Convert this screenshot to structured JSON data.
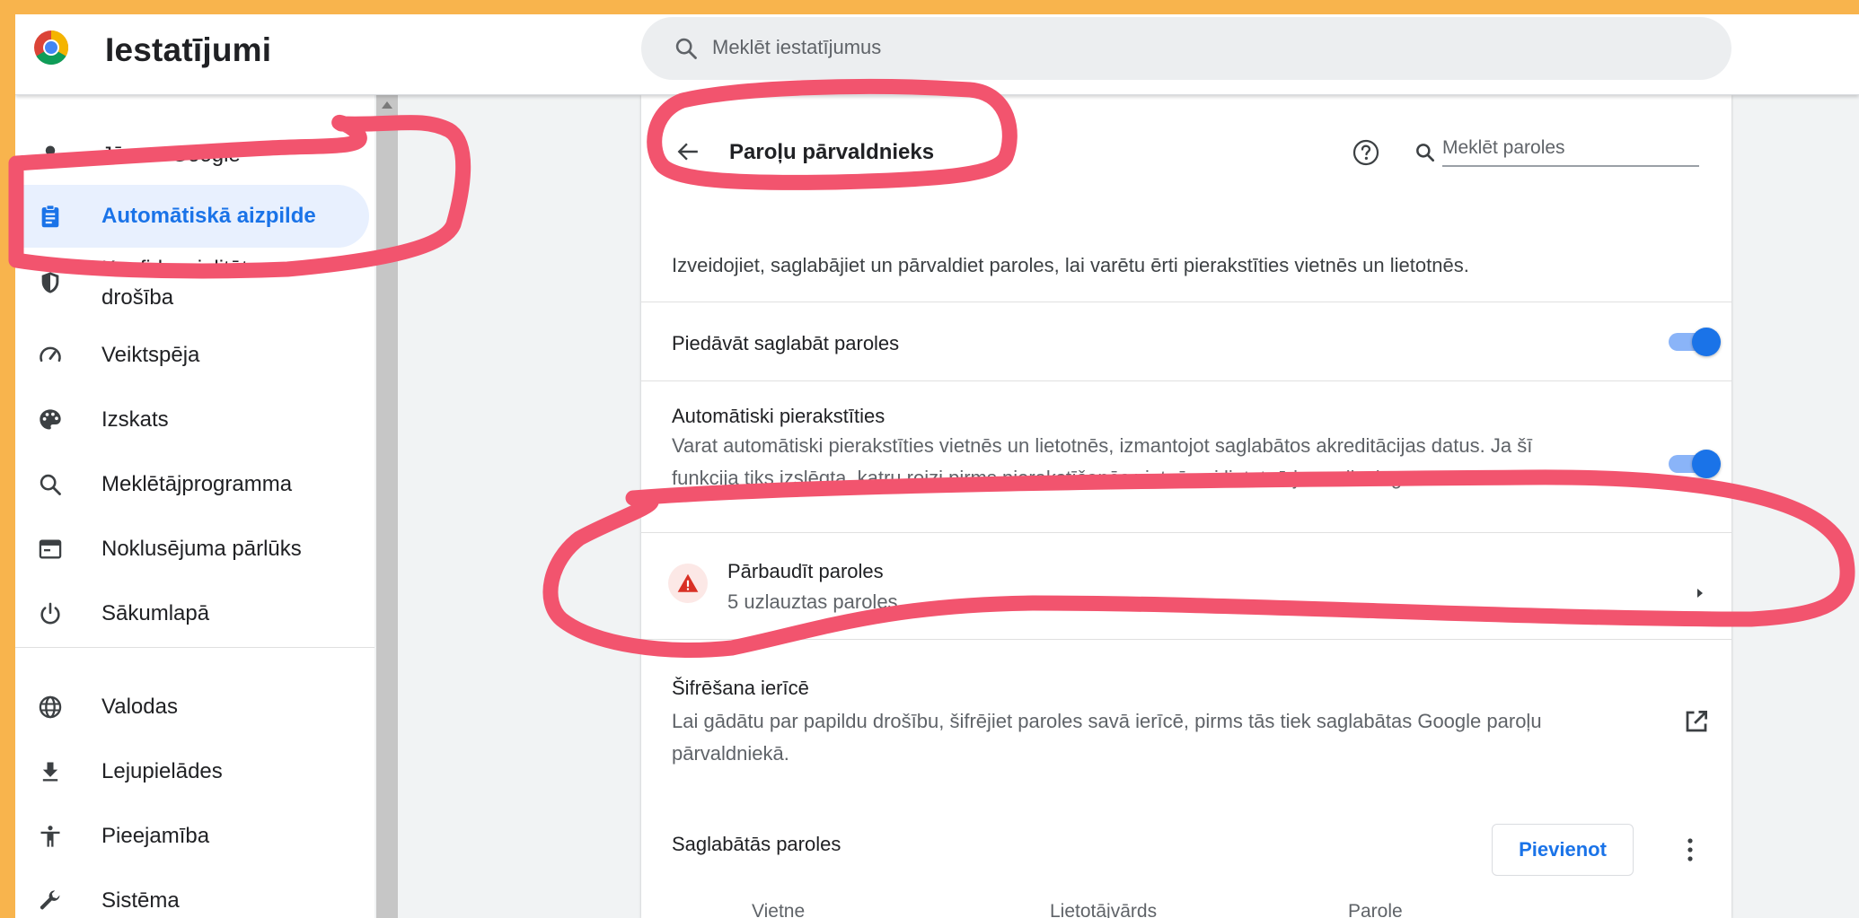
{
  "header": {
    "app_title": "Iestatījumi",
    "search_placeholder": "Meklēt iestatījumus"
  },
  "sidebar": {
    "items": [
      {
        "label": "Jūs un Google",
        "icon": "person-icon"
      },
      {
        "label": "Automātiskā aizpilde",
        "icon": "clipboard-icon",
        "active": true
      },
      {
        "label": "Konfidencialitāte un drošība",
        "icon": "shield-icon"
      },
      {
        "label": "Veiktspēja",
        "icon": "speedometer-icon"
      },
      {
        "label": "Izskats",
        "icon": "palette-icon"
      },
      {
        "label": "Meklētājprogramma",
        "icon": "search-icon"
      },
      {
        "label": "Noklusējuma pārlūks",
        "icon": "browser-icon"
      },
      {
        "label": "Sākumlapā",
        "icon": "power-icon"
      },
      {
        "label": "Valodas",
        "icon": "globe-icon"
      },
      {
        "label": "Lejupielādes",
        "icon": "download-icon"
      },
      {
        "label": "Pieejamība",
        "icon": "accessibility-icon"
      },
      {
        "label": "Sistēma",
        "icon": "wrench-icon"
      }
    ]
  },
  "main": {
    "title": "Paroļu pārvaldnieks",
    "search_placeholder": "Meklēt paroles",
    "description": "Izveidojiet, saglabājiet un pārvaldiet paroles, lai varētu ērti pierakstīties vietnēs un lietotnēs.",
    "offer_save": {
      "label": "Piedāvāt saglabāt paroles",
      "enabled": true
    },
    "auto_signin": {
      "label": "Automātiski pierakstīties",
      "description_line1": "Varat automātiski pierakstīties vietnēs un lietotnēs, izmantojot saglabātos akreditācijas datus. Ja šī",
      "description_line2": "funkcija tiks izslēgta, katru reizi pirms pierakstīšanās vietnē vai lietotnē jums tiks lūgts",
      "enabled": true
    },
    "check_passwords": {
      "label": "Pārbaudīt paroles",
      "sub": "5 uzlauztas paroles"
    },
    "on_device_encryption": {
      "label": "Šifrēšana ierīcē",
      "description_line1": "Lai gādātu par papildu drošību, šifrējiet paroles savā ierīcē, pirms tās tiek saglabātas Google paroļu",
      "description_line2": "pārvaldniekā."
    },
    "saved_passwords": {
      "label": "Saglabātās paroles",
      "add_button": "Pievienot",
      "columns": [
        "Vietne",
        "Lietotājvārds",
        "Parole"
      ]
    }
  },
  "colors": {
    "background_frame": "#f8b44d",
    "accent": "#1a73e8",
    "annotation": "#f2546e",
    "warning": "#d93025"
  }
}
